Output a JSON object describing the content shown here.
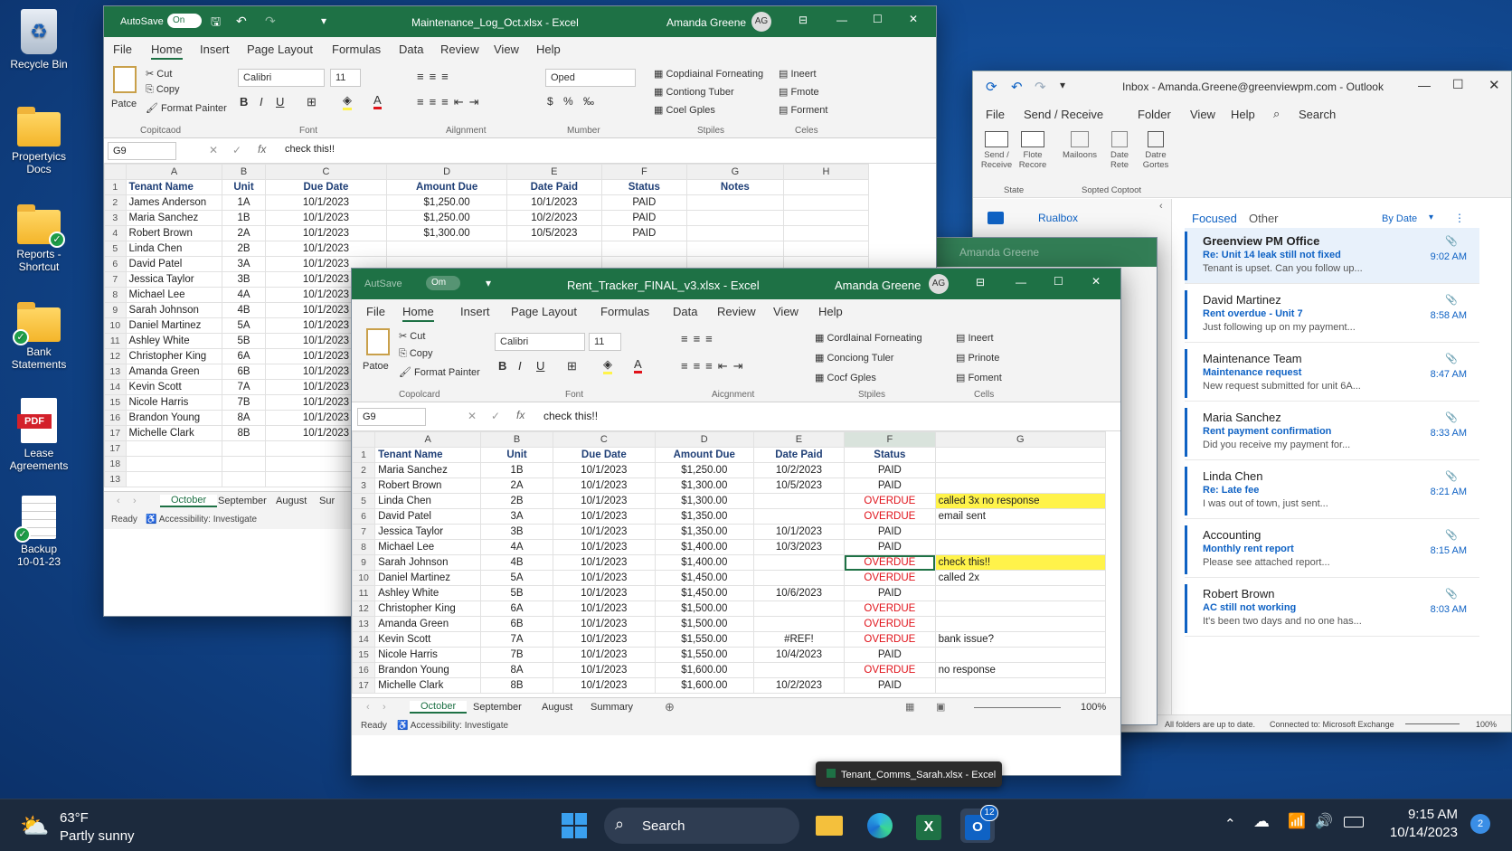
{
  "desktop": {
    "icons": [
      {
        "label": "Recycle Bin"
      },
      {
        "label": "Propertyics Docs"
      },
      {
        "label": "Reports - Shortcut"
      },
      {
        "label": "Bank Statements"
      },
      {
        "label": "Lease Agreements",
        "badge": "PDF"
      },
      {
        "label": "Backup 10-01-23"
      }
    ]
  },
  "excel_back": {
    "autosave": "AutoSave",
    "autosave_state": "On",
    "title": "Maintenance_Log_Oct.xlsx - Excel",
    "user": "Amanda Greene",
    "avatar": "AG",
    "menu": [
      "File",
      "Home",
      "Insert",
      "Page Layout",
      "Formulas",
      "Data",
      "Review",
      "View",
      "Help"
    ],
    "ribbon": {
      "paste": "Patce",
      "cut": "Cut",
      "copy": "Copy",
      "fmt": "Format Painter",
      "font": "Calibri",
      "size": "11",
      "numfmt": "Oped",
      "cond": "Copdiainal Forneating",
      "table": "Contiong Tuber",
      "styles": "Coel Gples",
      "insert": "Ineert",
      "delete": "Fmote",
      "format": "Forment",
      "groups": [
        "Copitcaod",
        "Font",
        "Ailgnment",
        "Mumber",
        "Stpiles",
        "Celes"
      ]
    },
    "cellref": "G9",
    "formula": "check this!!",
    "cols": [
      "A",
      "B",
      "C",
      "D",
      "E",
      "F",
      "G",
      "H"
    ],
    "rows": [
      [
        "1",
        "Tenant Name",
        "Unit",
        "Due Date",
        "Amount Due",
        "Date Paid",
        "Status",
        "Notes",
        ""
      ],
      [
        "2",
        "James Anderson",
        "1A",
        "10/1/2023",
        "$1,250.00",
        "10/1/2023",
        "PAID",
        "",
        ""
      ],
      [
        "3",
        "Maria Sanchez",
        "1B",
        "10/1/2023",
        "$1,250.00",
        "10/2/2023",
        "PAID",
        "",
        ""
      ],
      [
        "4",
        "Robert Brown",
        "2A",
        "10/1/2023",
        "$1,300.00",
        "10/5/2023",
        "PAID",
        "",
        ""
      ],
      [
        "5",
        "Linda Chen",
        "2B",
        "10/1/2023",
        "",
        "",
        "",
        "",
        ""
      ],
      [
        "6",
        "David Patel",
        "3A",
        "10/1/2023",
        "",
        "",
        "",
        "",
        ""
      ],
      [
        "7",
        "Jessica Taylor",
        "3B",
        "10/1/2023",
        "",
        "",
        "",
        "",
        ""
      ],
      [
        "8",
        "Michael Lee",
        "4A",
        "10/1/2023",
        "",
        "",
        "",
        "",
        ""
      ],
      [
        "9",
        "Sarah Johnson",
        "4B",
        "10/1/2023",
        "",
        "",
        "",
        "",
        ""
      ],
      [
        "10",
        "Daniel Martinez",
        "5A",
        "10/1/2023",
        "",
        "",
        "",
        "",
        ""
      ],
      [
        "11",
        "Ashley White",
        "5B",
        "10/1/2023",
        "",
        "",
        "",
        "",
        ""
      ],
      [
        "12",
        "Christopher King",
        "6A",
        "10/1/2023",
        "",
        "",
        "",
        "",
        ""
      ],
      [
        "13",
        "Amanda Green",
        "6B",
        "10/1/2023",
        "",
        "",
        "",
        "",
        ""
      ],
      [
        "14",
        "Kevin Scott",
        "7A",
        "10/1/2023",
        "",
        "",
        "",
        "",
        ""
      ],
      [
        "15",
        "Nicole Harris",
        "7B",
        "10/1/2023",
        "",
        "",
        "",
        "",
        ""
      ],
      [
        "16",
        "Brandon Young",
        "8A",
        "10/1/2023",
        "",
        "",
        "",
        "",
        ""
      ],
      [
        "17",
        "Michelle Clark",
        "8B",
        "10/1/2023",
        "",
        "",
        "",
        "",
        ""
      ],
      [
        "17",
        "",
        "",
        "",
        "",
        "",
        "",
        "",
        ""
      ],
      [
        "18",
        "",
        "",
        "",
        "",
        "",
        "",
        "",
        ""
      ],
      [
        "13",
        "",
        "",
        "",
        "",
        "",
        "",
        "",
        ""
      ]
    ],
    "tabs": [
      "October",
      "September",
      "August",
      "Sur"
    ],
    "status": "Ready",
    "access": "Accessibility: Investigate"
  },
  "excel_front": {
    "autosave": "AutSave",
    "autosave_state": "Om",
    "title": "Rent_Tracker_FINAL_v3.xlsx - Excel",
    "user": "Amanda Greene",
    "avatar": "AG",
    "menu": [
      "File",
      "Home",
      "Insert",
      "Page Layout",
      "Formulas",
      "Data",
      "Review",
      "View",
      "Help"
    ],
    "ribbon": {
      "paste": "Patoe",
      "cut": "Cut",
      "copy": "Copy",
      "fmt": "Format Painter",
      "font": "Calibri",
      "size": "11",
      "cond": "Cordlainal Forneating",
      "table": "Conciong Tuler",
      "styles": "Cocf Gples",
      "insert": "Ineert",
      "delete": "Prinote",
      "format": "Foment",
      "groups": [
        "Copolcard",
        "Font",
        "Aicgnment",
        "Stpiles",
        "Cells"
      ]
    },
    "cellref": "G9",
    "formula": "check this!!",
    "cols": [
      "A",
      "B",
      "C",
      "D",
      "E",
      "F",
      "G"
    ],
    "rows": [
      [
        "1",
        "Tenant Name",
        "Unit",
        "Due Date",
        "Amount Due",
        "Date Paid",
        "Status",
        ""
      ],
      [
        "2",
        "Maria Sanchez",
        "1B",
        "10/1/2023",
        "$1,250.00",
        "10/2/2023",
        "PAID",
        ""
      ],
      [
        "3",
        "Robert Brown",
        "2A",
        "10/1/2023",
        "$1,300.00",
        "10/5/2023",
        "PAID",
        ""
      ],
      [
        "5",
        "Linda Chen",
        "2B",
        "10/1/2023",
        "$1,300.00",
        "",
        "OVERDUE",
        "called 3x no response"
      ],
      [
        "6",
        "David Patel",
        "3A",
        "10/1/2023",
        "$1,350.00",
        "",
        "OVERDUE",
        "email sent"
      ],
      [
        "7",
        "Jessica Taylor",
        "3B",
        "10/1/2023",
        "$1,350.00",
        "10/1/2023",
        "PAID",
        ""
      ],
      [
        "8",
        "Michael Lee",
        "4A",
        "10/1/2023",
        "$1,400.00",
        "10/3/2023",
        "PAID",
        ""
      ],
      [
        "9",
        "Sarah Johnson",
        "4B",
        "10/1/2023",
        "$1,400.00",
        "",
        "OVERDUE",
        "check this!!"
      ],
      [
        "10",
        "Daniel Martinez",
        "5A",
        "10/1/2023",
        "$1,450.00",
        "",
        "OVERDUE",
        "called 2x"
      ],
      [
        "11",
        "Ashley White",
        "5B",
        "10/1/2023",
        "$1,450.00",
        "10/6/2023",
        "PAID",
        ""
      ],
      [
        "12",
        "Christopher King",
        "6A",
        "10/1/2023",
        "$1,500.00",
        "",
        "OVERDUE",
        ""
      ],
      [
        "13",
        "Amanda Green",
        "6B",
        "10/1/2023",
        "$1,500.00",
        "",
        "OVERDUE",
        ""
      ],
      [
        "14",
        "Kevin Scott",
        "7A",
        "10/1/2023",
        "$1,550.00",
        "#REF!",
        "OVERDUE",
        "bank issue?"
      ],
      [
        "15",
        "Nicole Harris",
        "7B",
        "10/1/2023",
        "$1,550.00",
        "10/4/2023",
        "PAID",
        ""
      ],
      [
        "16",
        "Brandon Young",
        "8A",
        "10/1/2023",
        "$1,600.00",
        "",
        "OVERDUE",
        "no response"
      ],
      [
        "17",
        "Michelle Clark",
        "8B",
        "10/1/2023",
        "$1,600.00",
        "10/2/2023",
        "PAID",
        ""
      ]
    ],
    "tabs": [
      "October",
      "September",
      "August",
      "Summary"
    ],
    "zoom": "100%",
    "status": "Ready",
    "access": "Accessibility: Investigate"
  },
  "ghost_title": "Amanda Greene",
  "outlook": {
    "title": "Inbox - Amanda.Greene@greenviewpm.com - Outlook",
    "menu": [
      "File",
      "Send / Receive",
      "Folder",
      "View",
      "Help"
    ],
    "search": "Search",
    "ribbon": [
      "Send / Receive",
      "Flote Recore",
      "Mailoons",
      "Date Rete",
      "Datre Gortes"
    ],
    "groups": [
      "State",
      "Sopted Coptoot"
    ],
    "folder": "Rualbox",
    "focused": "Focused",
    "other": "Other",
    "sort": "By Date",
    "emails": [
      {
        "sender": "Greenview PM Office",
        "subject": "Re: Unit 14 leak still not fixed",
        "preview": "Tenant is upset. Can you follow up...",
        "time": "9:02 AM"
      },
      {
        "sender": "David Martinez",
        "subject": "Rent overdue - Unit 7",
        "preview": "Just following up on my payment...",
        "time": "8:58 AM"
      },
      {
        "sender": "Maintenance Team",
        "subject": "Maintenance request",
        "preview": "New request submitted for unit 6A...",
        "time": "8:47 AM"
      },
      {
        "sender": "Maria Sanchez",
        "subject": "Rent payment confirmation",
        "preview": "Did you receive my payment for...",
        "time": "8:33 AM"
      },
      {
        "sender": "Linda Chen",
        "subject": "Re: Late fee",
        "preview": "I was out of town, just sent...",
        "time": "8:21 AM"
      },
      {
        "sender": "Accounting",
        "subject": "Monthly rent report",
        "preview": "Please see attached report...",
        "time": "8:15 AM"
      },
      {
        "sender": "Robert Brown",
        "subject": "AC still not working",
        "preview": "It's been two days and no one has...",
        "time": "8:03 AM"
      }
    ],
    "status_left": "All folders are up to date.",
    "status_mid": "Connected to: Microsoft Exchange",
    "zoom": "100%"
  },
  "tooltip": "Tenant_Comms_Sarah.xlsx - Excel",
  "taskbar": {
    "temp": "63°F",
    "weather": "Partly sunny",
    "search": "Search",
    "badge": "12",
    "time": "9:15 AM",
    "date": "10/14/2023",
    "notif": "2"
  },
  "colors": {
    "excel_green": "#1e7145",
    "overdue": "#e0121a",
    "highlight": "#fff34a",
    "outlook_blue": "#0f62c4"
  }
}
